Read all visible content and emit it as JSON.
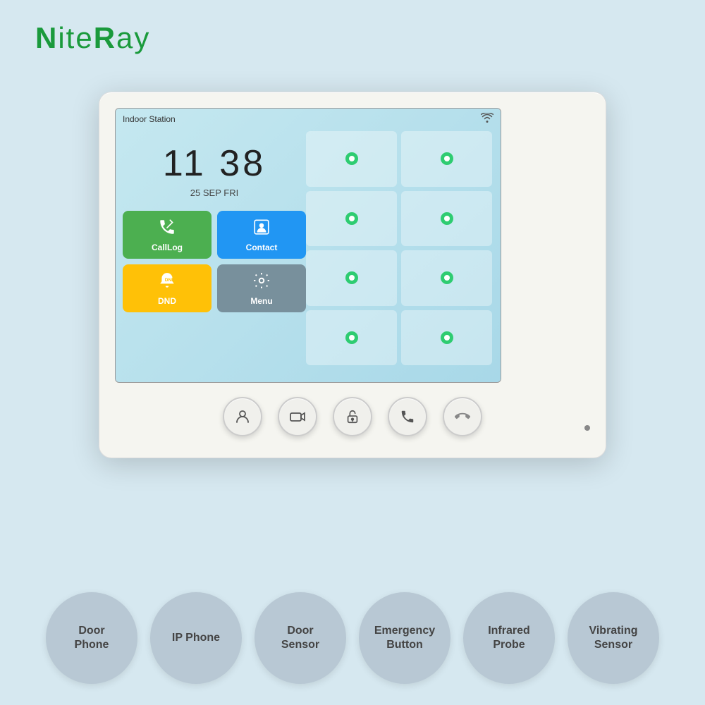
{
  "brand": {
    "name": "NiteRay",
    "name_part1": "N",
    "name_part2": "ite",
    "name_part3": "R",
    "name_part4": "ay"
  },
  "screen": {
    "title": "Indoor Station",
    "time": "11  38",
    "date": "25 SEP FRI",
    "wifi_symbol": "📶"
  },
  "apps": [
    {
      "label": "CallLog",
      "icon": "📞",
      "color": "green"
    },
    {
      "label": "Contact",
      "icon": "📒",
      "color": "blue"
    },
    {
      "label": "DND",
      "icon": "🔕",
      "color": "yellow"
    },
    {
      "label": "Menu",
      "icon": "⚙️",
      "color": "gray-blue"
    }
  ],
  "physical_buttons": [
    {
      "icon": "👤",
      "label": "person"
    },
    {
      "icon": "📹",
      "label": "camera"
    },
    {
      "icon": "🔓",
      "label": "unlock"
    },
    {
      "icon": "📞",
      "label": "call-in"
    },
    {
      "icon": "📵",
      "label": "call-end"
    }
  ],
  "features": [
    {
      "label": "Door\nPhone",
      "id": "door-phone"
    },
    {
      "label": "IP Phone",
      "id": "ip-phone"
    },
    {
      "label": "Door\nSensor",
      "id": "door-sensor"
    },
    {
      "label": "Emergency\nButton",
      "id": "emergency-button"
    },
    {
      "label": "Infrared\nProbe",
      "id": "infrared-probe"
    },
    {
      "label": "Vibrating\nSensor",
      "id": "vibrating-sensor"
    }
  ]
}
